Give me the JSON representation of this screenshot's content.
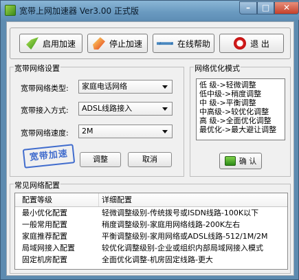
{
  "window": {
    "title": "宽带上网加速器  Ver3.00 正式版",
    "min_symbol": "–",
    "max_symbol": "□",
    "close_symbol": "✕"
  },
  "toolbar": {
    "start_label": "启用加速",
    "stop_label": "停止加速",
    "help_label": "在线帮助",
    "exit_label": "退  出"
  },
  "settings": {
    "title": "宽带网络设置",
    "type_label": "宽带网络类型:",
    "type_value": "家庭电话网络",
    "access_label": "宽带接入方式:",
    "access_value": "ADSL线路接入",
    "speed_label": "宽带网络速度:",
    "speed_value": "2M",
    "stamp_text": "宽带加速",
    "adjust_label": "调整",
    "cancel_label": "取消"
  },
  "optimize": {
    "title": "网络优化模式",
    "modes": [
      "低   级->轻微调整",
      "低中级->稍度调整",
      "中   级->平衡调整",
      "中高级->较优化调整",
      "高   级->全面优化调整",
      "最优化->最大避让调整"
    ],
    "confirm_label": "确 认"
  },
  "common": {
    "title": "常见网络配置",
    "headers": [
      "配置等级",
      "详细配置"
    ],
    "rows": [
      [
        "最小优化配置",
        "轻微调整级别-传统拨号或ISDN线路-100K以下"
      ],
      [
        "一般常用配置",
        "稍度调整级别-家庭用网络线路-200K左右"
      ],
      [
        "家庭推荐配置",
        "平衡调整级别-家用网络或ADSL线路-512/1M/2M"
      ],
      [
        "局域网接入配置",
        "较优化调整级别-企业或组织内部局域网接入模式"
      ],
      [
        "固定机房配置",
        "全面优化调整-机房固定线路-更大"
      ]
    ]
  },
  "icons": [
    "app-icon",
    "start-icon",
    "stop-icon",
    "help-icon",
    "exit-icon",
    "confirm-icon",
    "dropdown-arrow-icon"
  ]
}
